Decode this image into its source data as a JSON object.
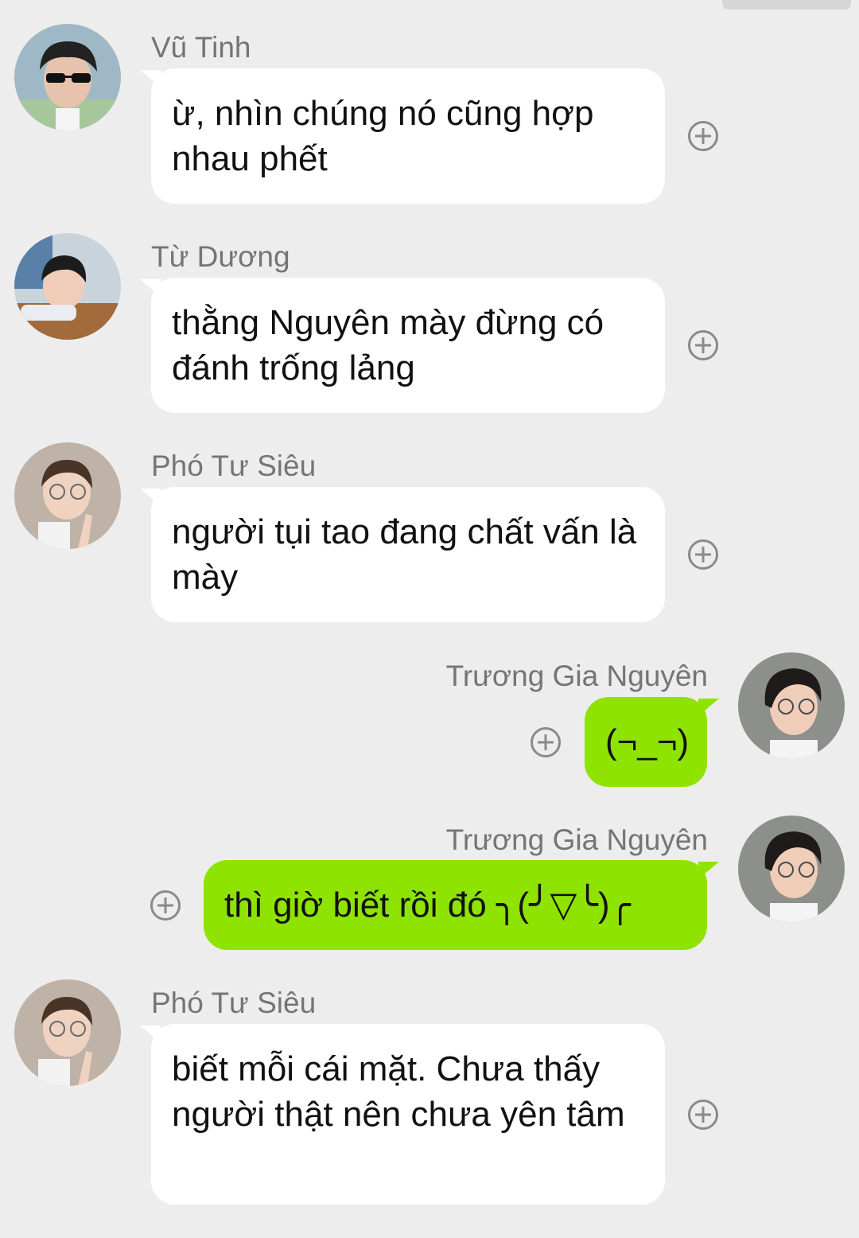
{
  "messages": [
    {
      "sender": "Vũ Tinh",
      "text": "ừ, nhìn chúng nó cũng hợp nhau phết",
      "direction": "incoming",
      "avatar_icon": "avatar-sunglasses-boy"
    },
    {
      "sender": "Từ Dương",
      "text": "thằng Nguyên mày đừng có đánh trống lảng",
      "direction": "incoming",
      "avatar_icon": "avatar-boy-at-table"
    },
    {
      "sender": "Phó Tư Siêu",
      "text": "người tụi tao đang chất vấn là mày",
      "direction": "incoming",
      "avatar_icon": "avatar-boy-glasses-peace"
    },
    {
      "sender": "Trương Gia Nguyên",
      "text": "(¬_¬)",
      "direction": "outgoing",
      "avatar_icon": "avatar-boy-glasses"
    },
    {
      "sender": "Trương Gia Nguyên",
      "text": "thì giờ biết rồi đó ╮(╯▽╰)╭",
      "direction": "outgoing",
      "avatar_icon": "avatar-boy-glasses"
    },
    {
      "sender": "Phó Tư Siêu",
      "text": "biết mỗi cái mặt. Chưa thấy người thật nên chưa yên tâm",
      "direction": "incoming",
      "avatar_icon": "avatar-boy-glasses-peace"
    }
  ],
  "icons": {
    "add": "plus-circle-icon"
  },
  "colors": {
    "background": "#ededed",
    "incoming_bubble": "#ffffff",
    "outgoing_bubble": "#8fe300",
    "name_text": "#757575",
    "plus_icon": "#8a8a8a"
  }
}
